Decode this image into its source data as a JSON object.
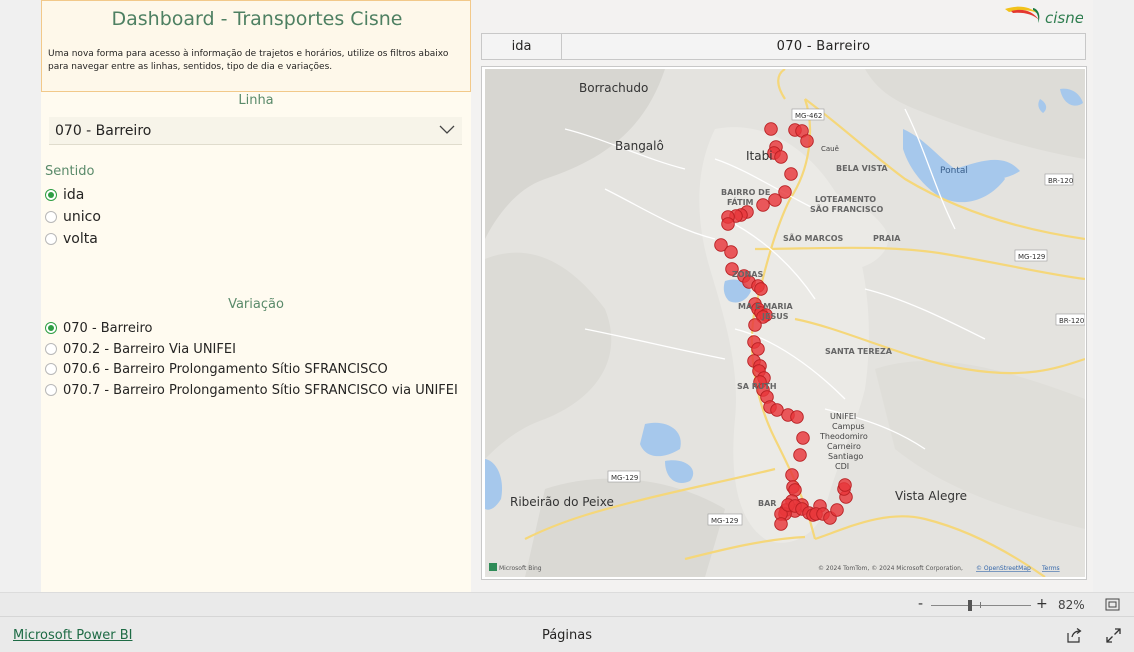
{
  "header": {
    "title": "Dashboard - Transportes Cisne",
    "description": "Uma nova forma para acesso à informação de trajetos e horários, utilize os filtros abaixo para navegar entre as linhas, sentidos, tipo de dia e variações."
  },
  "linha": {
    "title": "Linha",
    "selected": "070 - Barreiro"
  },
  "sentido": {
    "title": "Sentido",
    "options": [
      {
        "label": "ida",
        "selected": true
      },
      {
        "label": "unico",
        "selected": false
      },
      {
        "label": "volta",
        "selected": false
      }
    ]
  },
  "variacao": {
    "title": "Variação",
    "options": [
      {
        "label": "070 - Barreiro",
        "selected": true
      },
      {
        "label": "070.2 - Barreiro Via UNIFEI",
        "selected": false
      },
      {
        "label": "070.6 - Barreiro Prolongamento Sítio SFRANCISCO",
        "selected": false
      },
      {
        "label": "070.7 - Barreiro Prolongamento Sítio SFRANCISCO via UNIFEI",
        "selected": false
      }
    ]
  },
  "logo": {
    "text": "cisne"
  },
  "table": {
    "sentido": "ida",
    "linha": "070 - Barreiro"
  },
  "map": {
    "place_labels": {
      "borrachudo": "Borrachudo",
      "bangalo": "Bangalô",
      "itabira": "Itabi",
      "caue": "Cauê",
      "bela_vista": "BELA VISTA",
      "pontal": "Pontal",
      "br120_a": "BR-120",
      "br120_b": "BR-120",
      "bairro_fatima_1": "BAIRRO DE",
      "bairro_fatima_2": "FÁTIM",
      "loteamento_1": "LOTEAMENTO",
      "loteamento_2": "SÃO FRANCISCO",
      "sao_marcos": "SÃO MARCOS",
      "praia": "PRAIA",
      "mg129_a": "MG-129",
      "mg462": "MG-462",
      "zonas": "ZONAS",
      "maria_1": "MA   E MARIA",
      "maria_2": "JESUS",
      "santa_tereza": "SANTA TEREZA",
      "santa_ruth": "SA    RUTH",
      "unifei_1": "UNIFEI",
      "unifei_2": "Campus",
      "unifei_3": "Theodomiro",
      "unifei_4": "Carneiro",
      "unifei_5": "Santiago",
      "unifei_6": "CDI",
      "mg129_b": "MG-129",
      "mg129_c": "MG-129",
      "ribeirao": "Ribeirão do Peixe",
      "vista_alegre": "Vista Alegre",
      "barreiro": "BAR"
    },
    "bing_credit": "Microsoft Bing",
    "copyright": "© 2024 TomTom, © 2024 Microsoft Corporation, ",
    "osm_link": "© OpenStreetMap",
    "terms": "Terms",
    "route_color": "#e8373a"
  },
  "footer": {
    "zoom_minus": "-",
    "zoom_plus": "+",
    "zoom_level": "82%",
    "powerbi_link": "Microsoft Power BI",
    "pages": "Páginas"
  }
}
